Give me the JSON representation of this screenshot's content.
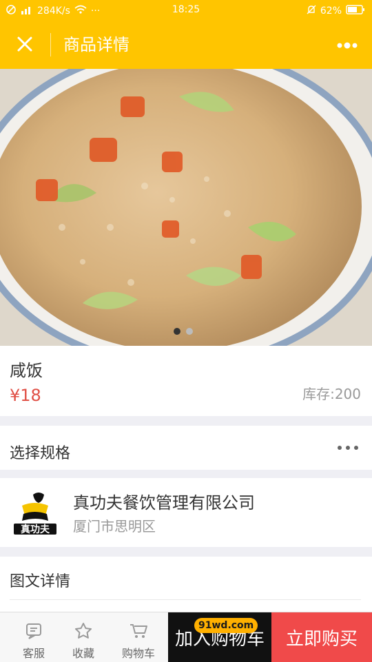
{
  "status": {
    "left_text": "284K/s",
    "time": "18:25",
    "battery": "62%"
  },
  "nav": {
    "title": "商品详情"
  },
  "product": {
    "name": "咸饭",
    "price": "¥18",
    "stock": "库存:200"
  },
  "spec": {
    "label": "选择规格"
  },
  "shop": {
    "logo_text": "真功夫",
    "name": "真功夫餐饮管理有限公司",
    "location": "厦门市思明区"
  },
  "detail": {
    "label": "图文详情"
  },
  "bottom": {
    "tabs": [
      {
        "label": "客服",
        "icon": "chat-icon"
      },
      {
        "label": "收藏",
        "icon": "star-icon"
      },
      {
        "label": "购物车",
        "icon": "cart-icon"
      }
    ],
    "add_to_cart": "加入购物车",
    "buy_now": "立即购买",
    "watermark": "91wd.com"
  },
  "colors": {
    "accent": "#ffc500",
    "price": "#e04f45",
    "buy": "#f04a4a"
  }
}
